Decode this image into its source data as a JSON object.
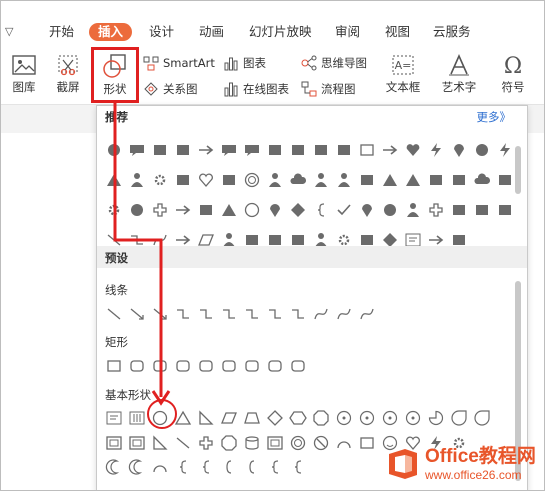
{
  "menu": {
    "tabs": [
      "开始",
      "插入",
      "设计",
      "动画",
      "幻灯片放映",
      "审阅",
      "视图",
      "云服务"
    ],
    "active_tab": "插入"
  },
  "ribbon": {
    "picture": "图库",
    "screenshot": "截屏",
    "shapes": "形状",
    "smartart": "SmartArt",
    "chart": "图表",
    "mindmap": "思维导图",
    "relation": "关系图",
    "online_chart": "在线图表",
    "flowchart": "流程图",
    "textbox": "文本框",
    "wordart": "艺术字",
    "symbol": "符号"
  },
  "panel": {
    "recommended": "推荐",
    "more": "更多》",
    "preset": "预设",
    "lines": "线条",
    "rectangles": "矩形",
    "basic_shapes": "基本形状"
  },
  "watermark": {
    "line1": "Office教程网",
    "line2": "www.office26.com"
  },
  "colors": {
    "accent": "#ec6b3c",
    "annotation": "#e02020",
    "link": "#2e6fd0",
    "watermark": "#e8552a"
  }
}
